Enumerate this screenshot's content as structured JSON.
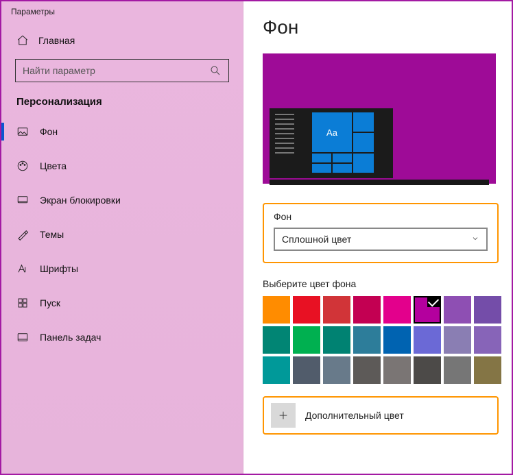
{
  "window": {
    "title": "Параметры"
  },
  "sidebar": {
    "home": "Главная",
    "search_placeholder": "Найти параметр",
    "section": "Персонализация",
    "items": [
      {
        "label": "Фон"
      },
      {
        "label": "Цвета"
      },
      {
        "label": "Экран блокировки"
      },
      {
        "label": "Темы"
      },
      {
        "label": "Шрифты"
      },
      {
        "label": "Пуск"
      },
      {
        "label": "Панель задач"
      }
    ]
  },
  "main": {
    "title": "Фон",
    "preview_tile_text": "Aa",
    "preview_bg_color": "#9e0b97",
    "bg_field_label": "Фон",
    "bg_dropdown_value": "Сплошной цвет",
    "picker_label": "Выберите цвет фона",
    "colors": [
      "#ff8c00",
      "#e81123",
      "#d13438",
      "#c30052",
      "#e3008c",
      "#b4009e",
      "#8e4fb3",
      "#744da9",
      "#018574",
      "#00b050",
      "#008272",
      "#2d7d9a",
      "#0063b1",
      "#6b69d6",
      "#8a7eb3",
      "#8764b8",
      "#009999",
      "#515c6b",
      "#687a8a",
      "#5d5a58",
      "#7a7574",
      "#4c4a48",
      "#767676",
      "#847545"
    ],
    "selected_color_index": 5,
    "custom_color_label": "Дополнительный цвет"
  }
}
